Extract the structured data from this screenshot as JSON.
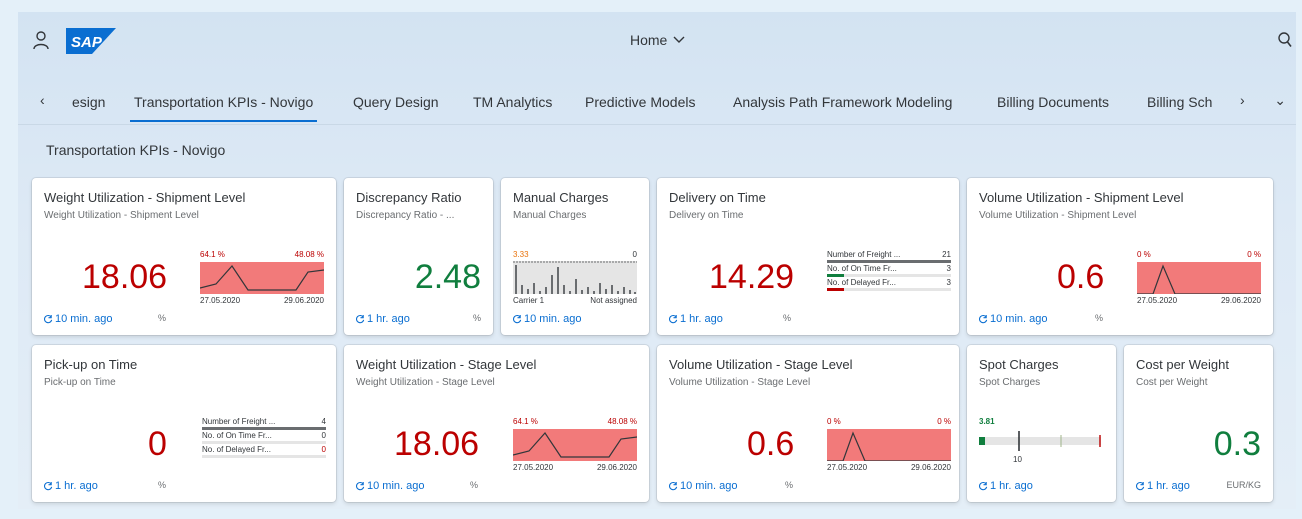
{
  "shell": {
    "logo": "SAP",
    "home_label": "Home",
    "icons": [
      "user-icon",
      "search-icon",
      "chevron-down-icon"
    ]
  },
  "tabs": [
    {
      "label": "esign"
    },
    {
      "label": "Transportation KPIs - Novigo",
      "active": true
    },
    {
      "label": "Query Design"
    },
    {
      "label": "TM Analytics"
    },
    {
      "label": "Predictive Models"
    },
    {
      "label": "Analysis Path Framework Modeling"
    },
    {
      "label": "Billing Documents"
    },
    {
      "label": "Billing Sch"
    }
  ],
  "tab_nav": {
    "prev": "‹",
    "next": "›",
    "overflow": "⌄"
  },
  "section_title": "Transportation KPIs - Novigo",
  "colors": {
    "negative": "#bb0000",
    "positive": "#107e3e",
    "accent": "#0a6ed1",
    "chart_fill": "#f27a7a"
  },
  "tiles": [
    {
      "title": "Weight Utilization - Shipment Level",
      "subtitle": "Weight Utilization - Shipment Level",
      "value": "18.06",
      "status": "negative",
      "refresh": "10 min. ago",
      "unit": "%",
      "chart": {
        "type": "area",
        "left_top": "64.1 %",
        "right_top": "48.08 %",
        "left_bottom": "27.05.2020",
        "right_bottom": "29.06.2020"
      }
    },
    {
      "title": "Discrepancy Ratio",
      "subtitle": "Discrepancy Ratio - ...",
      "value": "2.48",
      "status": "positive",
      "refresh": "1 hr. ago",
      "unit": "%"
    },
    {
      "title": "Manual Charges",
      "subtitle": "Manual Charges",
      "refresh": "10 min. ago",
      "chart": {
        "type": "column",
        "left_top": "3.33",
        "right_top": "0",
        "left_bottom": "Carrier 1",
        "right_bottom": "Not assigned"
      }
    },
    {
      "title": "Delivery on Time",
      "subtitle": "Delivery on Time",
      "value": "14.29",
      "status": "negative",
      "refresh": "1 hr. ago",
      "unit": "%",
      "comparison": [
        {
          "label": "Number of Freight ...",
          "value": "21",
          "fill": 1.0,
          "color": "#6a6d70"
        },
        {
          "label": "No. of On Time Fr...",
          "value": "3",
          "fill": 0.14,
          "color": "#107e3e"
        },
        {
          "label": "No. of Delayed Fr...",
          "value": "3",
          "fill": 0.14,
          "color": "#bb0000"
        }
      ]
    },
    {
      "title": "Volume Utilization - Shipment Level",
      "subtitle": "Volume Utilization - Shipment Level",
      "value": "0.6",
      "status": "negative",
      "refresh": "10 min. ago",
      "unit": "%",
      "chart": {
        "type": "area",
        "left_top": "0 %",
        "right_top": "0 %",
        "left_bottom": "27.05.2020",
        "right_bottom": "29.06.2020"
      }
    },
    {
      "title": "Pick-up on Time",
      "subtitle": "Pick-up on Time",
      "value": "0",
      "status": "negative",
      "refresh": "1 hr. ago",
      "unit": "%",
      "comparison": [
        {
          "label": "Number of Freight ...",
          "value": "4",
          "fill": 1.0,
          "color": "#6a6d70"
        },
        {
          "label": "No. of On Time Fr...",
          "value": "0",
          "fill": 0.0,
          "color": "#107e3e"
        },
        {
          "label": "No. of Delayed Fr...",
          "value": "0",
          "fill": 0.0,
          "color": "#bb0000"
        }
      ]
    },
    {
      "title": "Weight Utilization - Stage Level",
      "subtitle": "Weight Utilization - Stage Level",
      "value": "18.06",
      "status": "negative",
      "refresh": "10 min. ago",
      "unit": "%",
      "chart": {
        "type": "area",
        "left_top": "64.1 %",
        "right_top": "48.08 %",
        "left_bottom": "27.05.2020",
        "right_bottom": "29.06.2020"
      }
    },
    {
      "title": "Volume Utilization - Stage Level",
      "subtitle": "Volume Utilization - Stage Level",
      "value": "0.6",
      "status": "negative",
      "refresh": "10 min. ago",
      "unit": "%",
      "chart": {
        "type": "area",
        "left_top": "0 %",
        "right_top": "0 %",
        "left_bottom": "27.05.2020",
        "right_bottom": "29.06.2020"
      }
    },
    {
      "title": "Spot Charges",
      "subtitle": "Spot Charges",
      "refresh": "1 hr. ago",
      "bullet": {
        "value_label": "3.81",
        "target_label": "10"
      }
    },
    {
      "title": "Cost per Weight",
      "subtitle": "Cost per Weight",
      "value": "0.3",
      "status": "positive",
      "refresh": "1 hr. ago",
      "unit": "EUR/KG"
    }
  ]
}
